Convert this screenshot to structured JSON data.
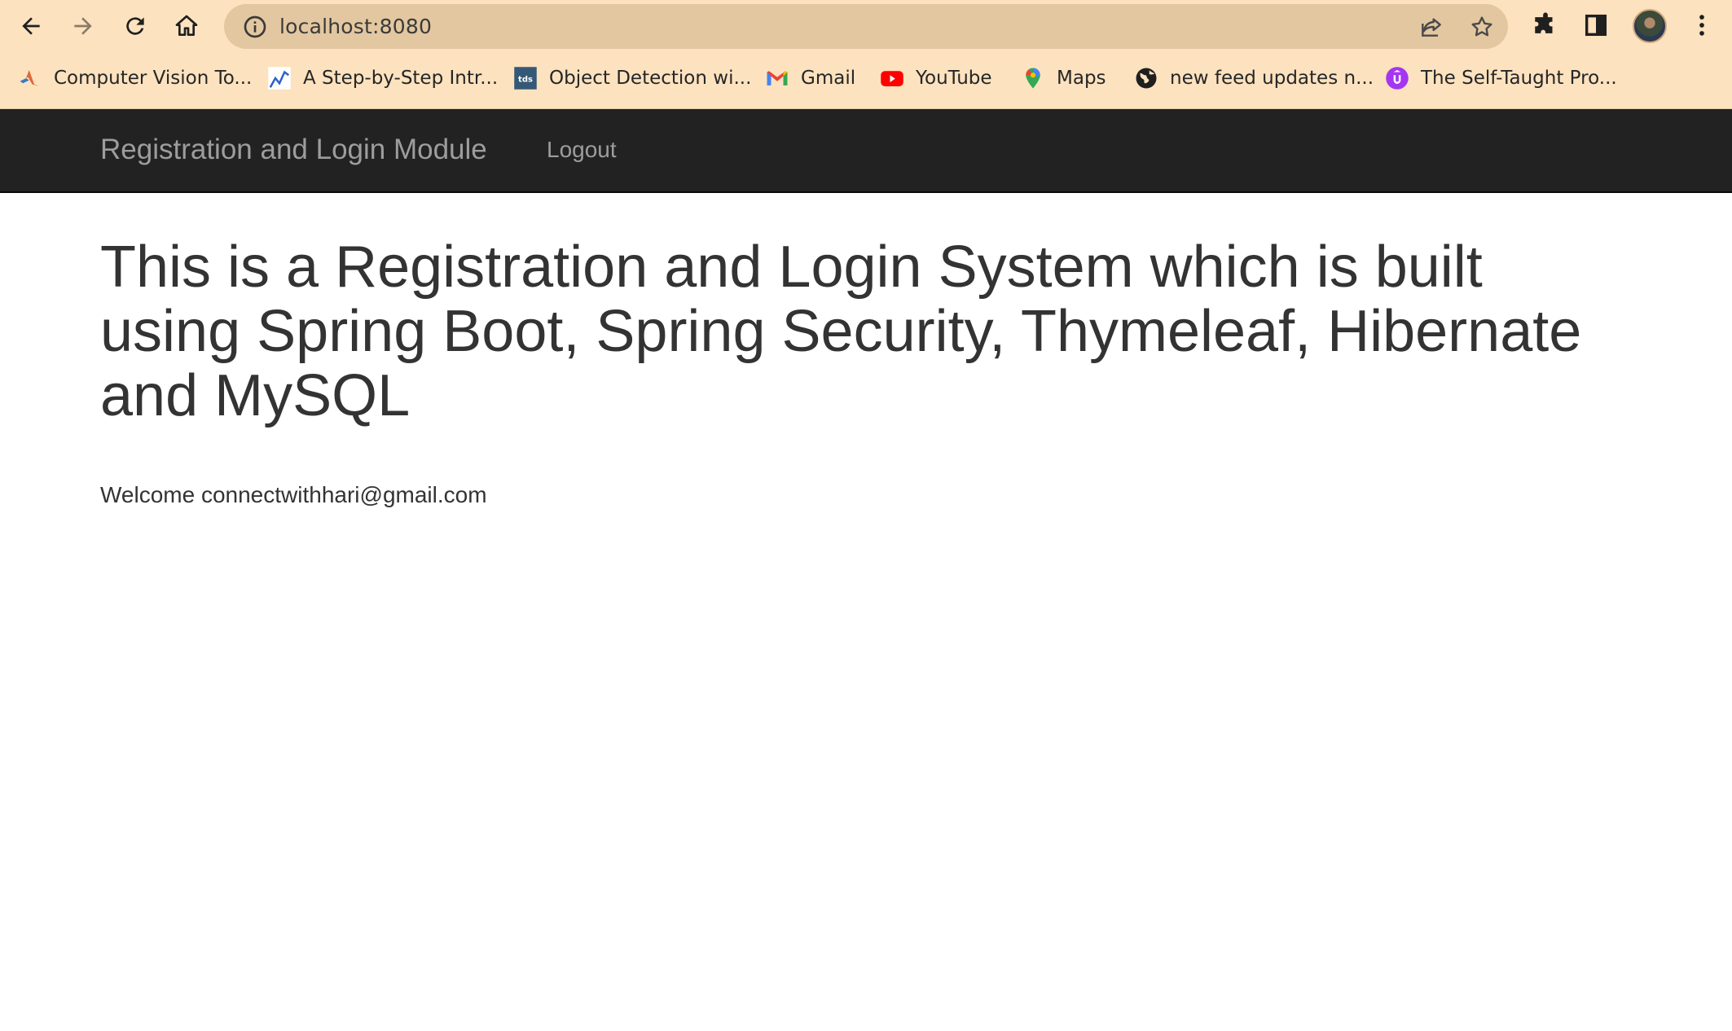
{
  "browser": {
    "url": "localhost:8080",
    "bookmarks": [
      {
        "label": "Computer Vision To...",
        "icon": "matlab-icon"
      },
      {
        "label": "A Step-by-Step Intr...",
        "icon": "chart-trend-icon"
      },
      {
        "label": "Object Detection wi...",
        "icon": "tds-icon"
      },
      {
        "label": "Gmail",
        "icon": "gmail-icon"
      },
      {
        "label": "YouTube",
        "icon": "youtube-icon"
      },
      {
        "label": "Maps",
        "icon": "maps-icon"
      },
      {
        "label": "new feed updates n...",
        "icon": "globe-icon"
      },
      {
        "label": "The Self-Taught Pro...",
        "icon": "udemy-icon"
      }
    ],
    "tds_badge": "tds"
  },
  "navbar": {
    "brand": "Registration and Login Module",
    "logout_label": "Logout"
  },
  "main": {
    "heading": "This is a Registration and Login System which is built using Spring Boot, Spring Security, Thymeleaf, Hibernate and MySQL",
    "welcome": "Welcome connectwithhari@gmail.com"
  },
  "colors": {
    "chrome_bg": "#fde2bf",
    "omnibox_bg": "#e3c7a0",
    "navbar_bg": "#222222",
    "navbar_text": "#9d9d9d",
    "body_text": "#333333"
  }
}
